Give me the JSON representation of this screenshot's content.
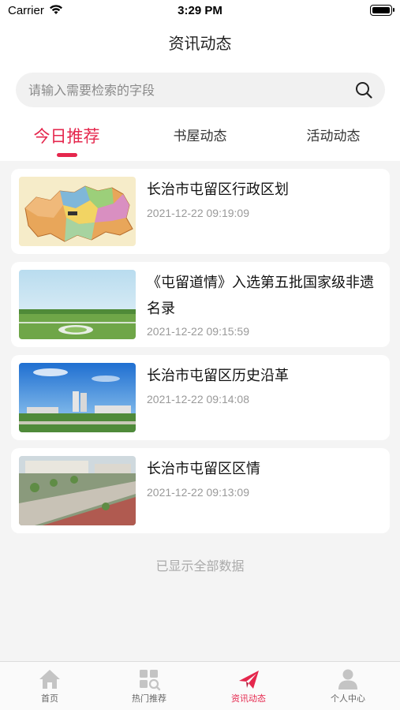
{
  "status_bar": {
    "carrier": "Carrier",
    "time": "3:29 PM"
  },
  "header": {
    "title": "资讯动态"
  },
  "search": {
    "placeholder": "请输入需要检索的字段"
  },
  "tabs": [
    {
      "label": "今日推荐",
      "active": true
    },
    {
      "label": "书屋动态",
      "active": false
    },
    {
      "label": "活动动态",
      "active": false
    }
  ],
  "articles": [
    {
      "title": "长治市屯留区行政区划",
      "date": "2021-12-22 09:19:09",
      "thumb": "map"
    },
    {
      "title": "《屯留道情》入选第五批国家级非遗名录",
      "date": "2021-12-22 09:15:59",
      "thumb": "park"
    },
    {
      "title": "长治市屯留区历史沿革",
      "date": "2021-12-22 09:14:08",
      "thumb": "city"
    },
    {
      "title": "长治市屯留区区情",
      "date": "2021-12-22 09:13:09",
      "thumb": "plaza"
    }
  ],
  "list_end_text": "已显示全部数据",
  "tabbar": [
    {
      "label": "首页",
      "icon": "home-icon",
      "active": false
    },
    {
      "label": "热门推荐",
      "icon": "hot-recommend-icon",
      "active": false
    },
    {
      "label": "资讯动态",
      "icon": "paper-plane-icon",
      "active": true
    },
    {
      "label": "个人中心",
      "icon": "person-icon",
      "active": false
    }
  ],
  "colors": {
    "accent": "#e5274d",
    "inactive_icon": "#c4c4c4"
  }
}
